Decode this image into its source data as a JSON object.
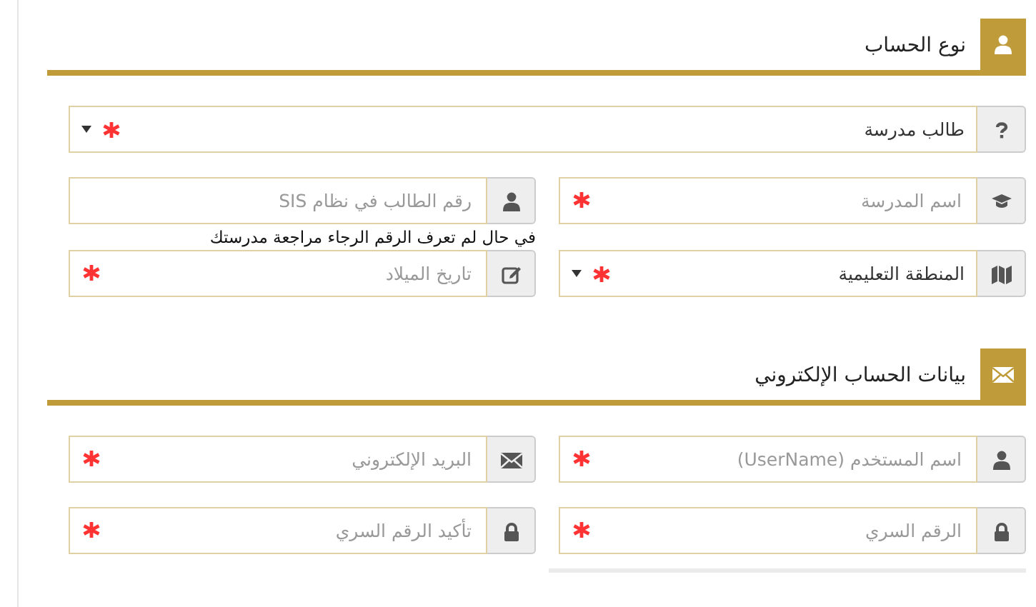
{
  "sections": [
    {
      "title": "نوع الحساب",
      "rows": [
        {
          "fields": [
            {
              "kind": "select",
              "value": "طالب مدرسة",
              "required": true
            }
          ]
        },
        {
          "fields": [
            {
              "kind": "input",
              "placeholder": "اسم المدرسة",
              "required": true
            },
            {
              "kind": "input",
              "placeholder": "رقم الطالب في نظام SIS",
              "required": false,
              "hint": "في حال لم تعرف الرقم الرجاء مراجعة مدرستك"
            }
          ]
        },
        {
          "fields": [
            {
              "kind": "select",
              "value": "المنطقة التعليمية",
              "required": true
            },
            {
              "kind": "input",
              "placeholder": "تاريخ الميلاد",
              "required": true
            }
          ]
        }
      ]
    },
    {
      "title": "بيانات الحساب الإلكتروني",
      "rows": [
        {
          "fields": [
            {
              "kind": "input",
              "placeholder": "اسم المستخدم (UserName)",
              "required": true
            },
            {
              "kind": "input",
              "placeholder": "البريد الإلكتروني",
              "required": true
            }
          ]
        },
        {
          "fields": [
            {
              "kind": "input",
              "placeholder": "الرقم السري",
              "required": true
            },
            {
              "kind": "input",
              "placeholder": "تأكيد الرقم السري",
              "required": true
            }
          ]
        }
      ]
    }
  ]
}
